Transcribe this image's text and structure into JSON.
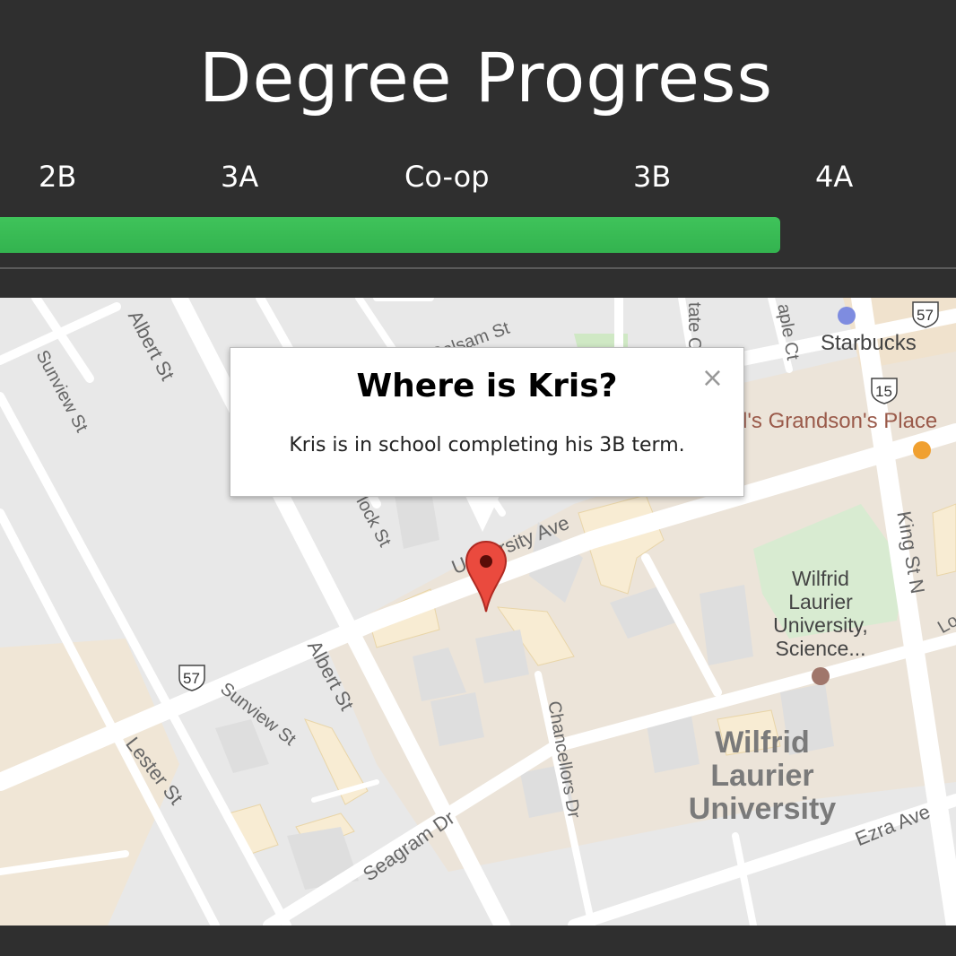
{
  "header": {
    "title": "Degree Progress",
    "terms": [
      {
        "label": "2B"
      },
      {
        "label": "3A"
      },
      {
        "label": "Co-op"
      },
      {
        "label": "3B"
      },
      {
        "label": "4A"
      }
    ],
    "progress_percent": 81.6,
    "progress_color": "#3fc35a"
  },
  "map": {
    "labels": {
      "albert_st_top": "Albert St",
      "sunview_st_top": "Sunview St",
      "balsam_st": "Balsam St",
      "state_ct": "tate C",
      "maple_ct": "aple Ct",
      "starbucks": "Starbucks",
      "route_57_top": "57",
      "route_15": "15",
      "grandsons_place": "l's Grandson's Place",
      "university_ave": "University Ave",
      "hemlock_st": "lock St",
      "king_st_n": "King St N",
      "lo": "Lo",
      "wlu_science_1": "Wilfrid",
      "wlu_science_2": "Laurier",
      "wlu_science_3": "University,",
      "wlu_science_4": "Science...",
      "route_57_bottom": "57",
      "albert_st_bottom": "Albert St",
      "sunview_st_bottom": "Sunview St",
      "lester_st": "Lester St",
      "chancellors_dr": "Chancellors Dr",
      "wlu_1": "Wilfrid",
      "wlu_2": "Laurier",
      "wlu_3": "University",
      "ezra_ave": "Ezra Ave",
      "seagram_dr": "Seagram Dr"
    },
    "marker_icon": "map-pin-icon"
  },
  "popup": {
    "title": "Where is Kris?",
    "text": "Kris is in school completing his 3B term.",
    "close_glyph": "×"
  }
}
